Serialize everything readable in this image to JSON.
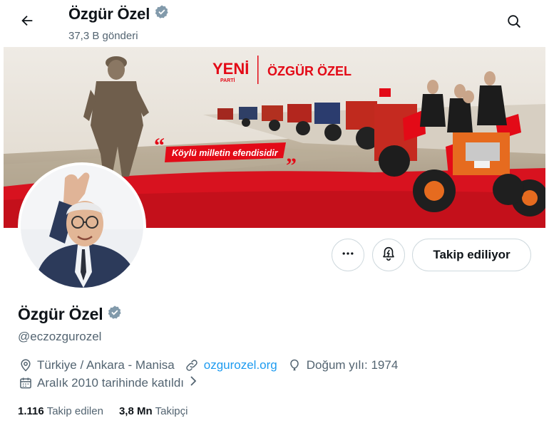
{
  "header": {
    "title": "Özgür Özel",
    "post_count": "37,3 B gönderi"
  },
  "banner": {
    "party_name": "YENİ",
    "party_sub": "PARTİ",
    "person": "ÖZGÜR ÖZEL",
    "quote": "Köylü milletin efendisidir"
  },
  "profile": {
    "name": "Özgür Özel",
    "handle": "@eczozgurozel",
    "location": "Türkiye / Ankara - Manisa",
    "website": "ozgurozel.org",
    "birth": "Doğum yılı: 1974",
    "joined": "Aralık 2010 tarihinde katıldı",
    "following_count": "1.116",
    "following_label": "Takip edilen",
    "followers_count": "3,8 Mn",
    "followers_label": "Takipçi"
  },
  "actions": {
    "follow_state": "Takip ediliyor"
  },
  "colors": {
    "verified": "#829aab",
    "link": "#1d9bf0",
    "banner_red": "#d8121f"
  },
  "icons": [
    "back-arrow-icon",
    "search-icon",
    "verified-badge-icon",
    "more-icon",
    "notification-bell-icon",
    "location-icon",
    "link-icon",
    "balloon-icon",
    "calendar-icon"
  ]
}
